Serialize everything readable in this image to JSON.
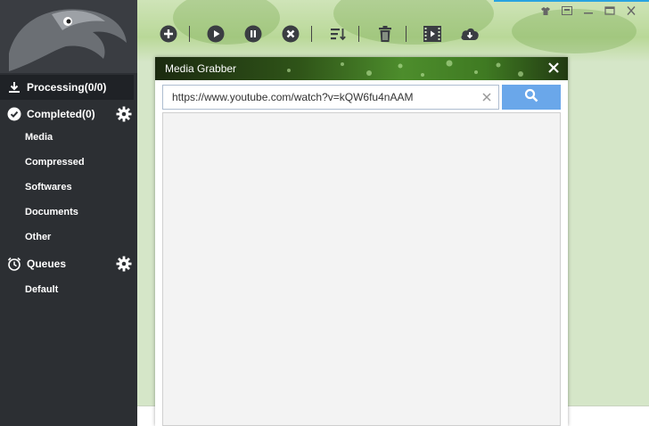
{
  "sidebar": {
    "processing_label": "Processing(0/0)",
    "completed_label": "Completed(0)",
    "categories": [
      "Media",
      "Compressed",
      "Softwares",
      "Documents",
      "Other"
    ],
    "queues_label": "Queues",
    "queue_items": [
      "Default"
    ]
  },
  "toolbar": {
    "buttons": [
      "add-icon",
      "play-icon",
      "pause-icon",
      "stop-icon",
      "sort-icon",
      "trash-icon",
      "film-icon",
      "cloud-download-icon"
    ]
  },
  "window_controls": [
    "skin-icon",
    "feedback-icon",
    "minimize-icon",
    "maximize-icon",
    "close-icon"
  ],
  "dialog": {
    "title": "Media Grabber",
    "url_value": "https://www.youtube.com/watch?v=kQW6fu4nAAM",
    "search_button_icon": "search-icon"
  },
  "colors": {
    "sidebar_bg": "#2c2f33",
    "accent_blue": "#6aa7ea",
    "background_green": "#d5e6c8"
  }
}
